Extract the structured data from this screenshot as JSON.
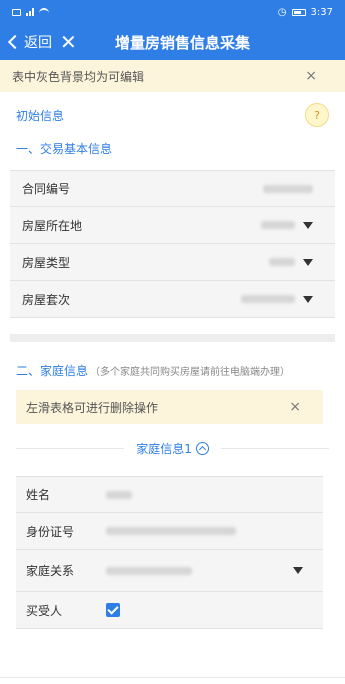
{
  "status_bar": {
    "time": "3:37"
  },
  "nav": {
    "back_label": "返回",
    "close_label": "✕",
    "title": "增量房销售信息采集"
  },
  "notice_top": {
    "text": "表中灰色背景均为可编辑",
    "close": "×"
  },
  "initial_info": {
    "label": "初始信息",
    "help": "?"
  },
  "section1": {
    "title": "一、交易基本信息",
    "rows": [
      {
        "label": "合同编号"
      },
      {
        "label": "房屋所在地"
      },
      {
        "label": "房屋类型"
      },
      {
        "label": "房屋套次"
      }
    ]
  },
  "section2": {
    "title": "二、家庭信息",
    "subtitle": "（多个家庭共同购买房屋请前往电脑端办理）"
  },
  "notice_swipe": {
    "text": "左滑表格可进行删除操作",
    "close": "×"
  },
  "family": {
    "header": "家庭信息1",
    "rows": [
      {
        "label": "姓名"
      },
      {
        "label": "身份证号"
      },
      {
        "label": "家庭关系"
      },
      {
        "label": "买受人"
      }
    ]
  },
  "colors": {
    "primary": "#2f7ee6",
    "notice_bg": "#fdf4dc",
    "field_bg": "#f5f5f5"
  }
}
